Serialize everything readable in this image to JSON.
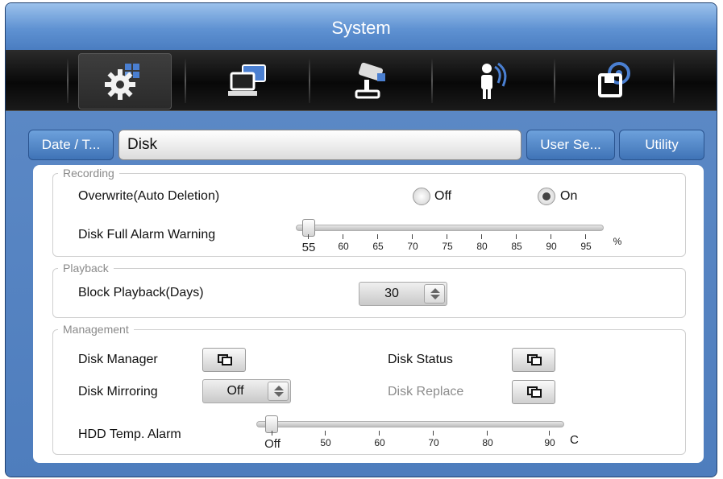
{
  "window": {
    "title": "System"
  },
  "toolbar": {
    "icons": [
      {
        "name": "system-settings-icon",
        "active": true
      },
      {
        "name": "network-icon",
        "active": false
      },
      {
        "name": "camera-icon",
        "active": false
      },
      {
        "name": "user-wifi-icon",
        "active": false
      },
      {
        "name": "disk-icon",
        "active": false
      }
    ]
  },
  "tabs": [
    {
      "label": "Date / T..."
    },
    {
      "label": "Disk",
      "selected": true
    },
    {
      "label": "User Se..."
    },
    {
      "label": "Utility"
    }
  ],
  "recording": {
    "legend": "Recording",
    "overwrite_label": "Overwrite(Auto Deletion)",
    "off_label": "Off",
    "on_label": "On",
    "overwrite_value": "On",
    "alarm_label": "Disk Full Alarm Warning",
    "alarm_ticks": [
      "55",
      "60",
      "65",
      "70",
      "75",
      "80",
      "85",
      "90",
      "95"
    ],
    "alarm_value": 55,
    "alarm_unit": "%"
  },
  "playback": {
    "legend": "Playback",
    "block_label": "Block Playback(Days)",
    "block_value": "30"
  },
  "management": {
    "legend": "Management",
    "disk_manager_label": "Disk Manager",
    "disk_status_label": "Disk Status",
    "mirroring_label": "Disk Mirroring",
    "mirroring_value": "Off",
    "replace_label": "Disk Replace",
    "temp_label": "HDD Temp. Alarm",
    "temp_ticks": [
      "Off",
      "50",
      "60",
      "70",
      "80",
      "90"
    ],
    "temp_value": "Off",
    "temp_unit": "C"
  },
  "colors": {
    "accent": "#4e7dbd",
    "panel": "#ffffff",
    "toolbar": "#111111"
  }
}
